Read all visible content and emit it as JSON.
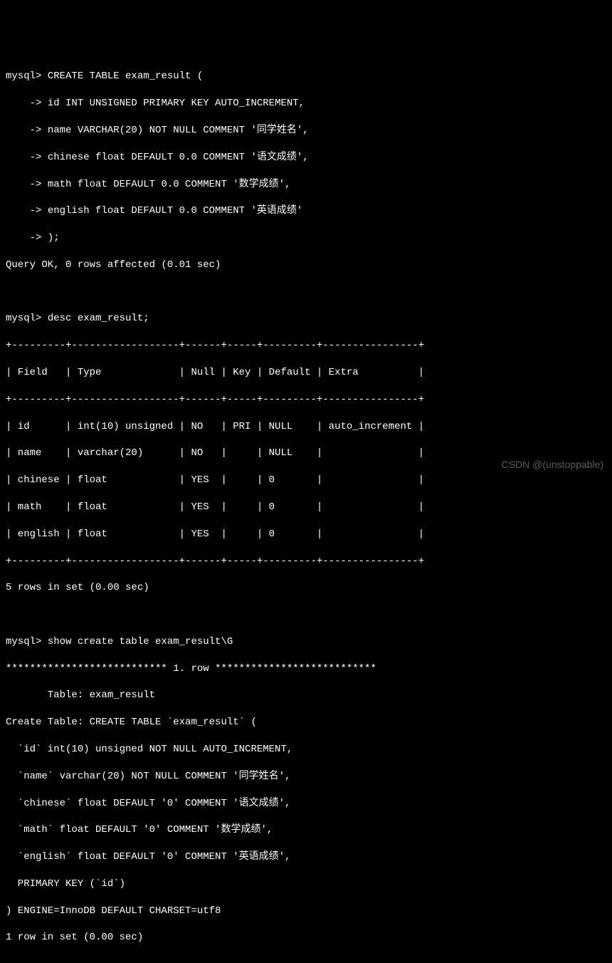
{
  "prompts": {
    "mysql": "mysql> ",
    "cont": "    -> "
  },
  "create_stmt": {
    "l0": "CREATE TABLE exam_result (",
    "l1": "id INT UNSIGNED PRIMARY KEY AUTO_INCREMENT,",
    "l2": "name VARCHAR(20) NOT NULL COMMENT '同学姓名',",
    "l3": "chinese float DEFAULT 0.0 COMMENT '语文成绩',",
    "l4": "math float DEFAULT 0.0 COMMENT '数学成绩',",
    "l5": "english float DEFAULT 0.0 COMMENT '英语成绩'",
    "l6": ");"
  },
  "query_ok": "Query OK, 0 rows affected (0.01 sec)",
  "desc_cmd": "desc exam_result;",
  "desc_table": {
    "sep": "+---------+------------------+------+-----+---------+----------------+",
    "hdr": "| Field   | Type             | Null | Key | Default | Extra          |",
    "r0": "| id      | int(10) unsigned | NO   | PRI | NULL    | auto_increment |",
    "r1": "| name    | varchar(20)      | NO   |     | NULL    |                |",
    "r2": "| chinese | float            | YES  |     | 0       |                |",
    "r3": "| math    | float            | YES  |     | 0       |                |",
    "r4": "| english | float            | YES  |     | 0       |                |"
  },
  "desc_footer": "5 rows in set (0.00 sec)",
  "show_cmd": "show create table exam_result\\G",
  "row_header": "*************************** 1. row ***************************",
  "show_output": {
    "l0": "       Table: exam_result",
    "l1": "Create Table: CREATE TABLE `exam_result` (",
    "l2": "  `id` int(10) unsigned NOT NULL AUTO_INCREMENT,",
    "l3": "  `name` varchar(20) NOT NULL COMMENT '同学姓名',",
    "l4": "  `chinese` float DEFAULT '0' COMMENT '语文成绩',",
    "l5": "  `math` float DEFAULT '0' COMMENT '数学成绩',",
    "l6": "  `english` float DEFAULT '0' COMMENT '英语成绩',",
    "l7": "  PRIMARY KEY (`id`)",
    "l8": ") ENGINE=InnoDB DEFAULT CHARSET=utf8"
  },
  "show_footer": "1 row in set (0.00 sec)",
  "watermark": "CSDN @(unstoppable)"
}
